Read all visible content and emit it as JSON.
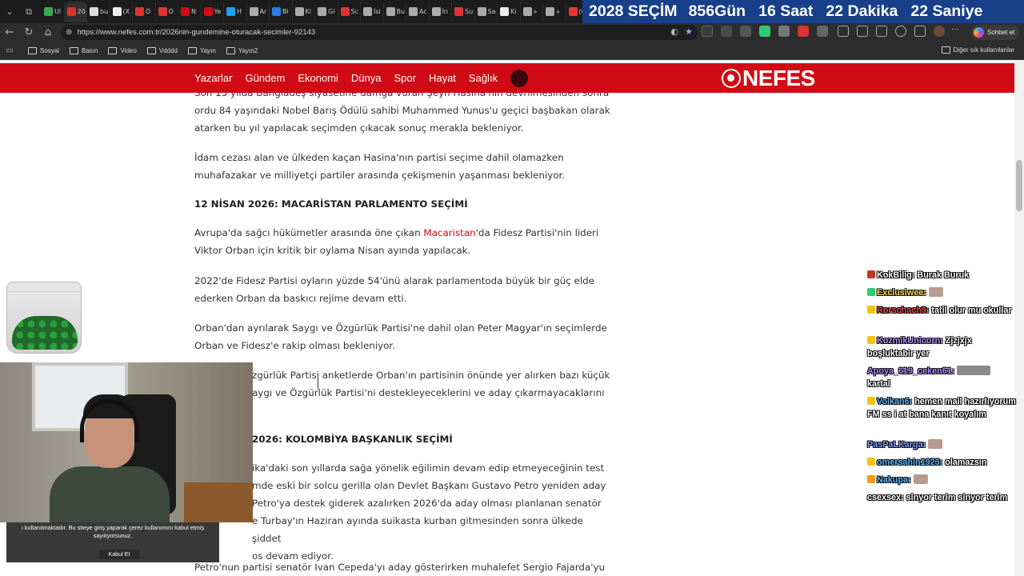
{
  "browser": {
    "tabs": [
      {
        "label": "Ul",
        "color": "#3aa757"
      },
      {
        "label": "20",
        "color": "#d33",
        "active": true
      },
      {
        "label": "bu",
        "color": "#ddd"
      },
      {
        "label": "(X",
        "color": "#eee"
      },
      {
        "label": "Ö",
        "color": "#d33"
      },
      {
        "label": "Ö",
        "color": "#d33"
      },
      {
        "label": "N",
        "color": "#d10b15"
      },
      {
        "label": "Ye",
        "color": "#d10b15"
      },
      {
        "label": "H",
        "color": "#1da1f2"
      },
      {
        "label": "Ar",
        "color": "#aaa"
      },
      {
        "label": "Bi",
        "color": "#2c7be5"
      },
      {
        "label": "Ki",
        "color": "#aaa"
      },
      {
        "label": "Gi",
        "color": "#aaa"
      },
      {
        "label": "Sc",
        "color": "#d33"
      },
      {
        "label": "İsi",
        "color": "#aaa"
      },
      {
        "label": "Bu",
        "color": "#aaa"
      },
      {
        "label": "Ac",
        "color": "#aaa"
      },
      {
        "label": "İn",
        "color": "#aaa"
      },
      {
        "label": "Su",
        "color": "#d33"
      },
      {
        "label": "Sa",
        "color": "#aaa"
      },
      {
        "label": "Ki",
        "color": "#eee"
      },
      {
        "label": "»",
        "color": "#aaa"
      },
      {
        "label": "»",
        "color": "#aaa"
      },
      {
        "label": "(6",
        "color": "#e33"
      },
      {
        "label": "(6",
        "color": "#e33"
      }
    ],
    "countdown": [
      "2028 SEÇİM",
      "856Gün",
      "16 Saat",
      "22 Dakika",
      "22 Saniye"
    ],
    "url": "https://www.nefes.com.tr/2026nin-gundemine-oturacak-secimler-92143",
    "copilot_label": "Sohbet et",
    "bookmarks": [
      "Sosyal",
      "Basın",
      "Video",
      "Vdddd",
      "Yayın",
      "Yayın2"
    ],
    "other_bookmarks": "Diğer sık kullanılanlar"
  },
  "site": {
    "nav": [
      "Yazarlar",
      "Gündem",
      "Ekonomi",
      "Dünya",
      "Spor",
      "Hayat",
      "Sağlık"
    ],
    "logo": "NEFES"
  },
  "article": {
    "p1a": "Son 15 yılda Bangladeş siyasetine damga vuran Şeyh Hasina'nın devrilmesinden sonra",
    "p1b": "ordu 84 yaşındaki Nobel Barış Ödülü sahibi Muhammed Yunus'u geçici başbakan olarak",
    "p1c": "atarken bu yıl yapılacak seçimden çıkacak sonuç merakla bekleniyor.",
    "p2a": "İdam cezası alan ve ülkeden kaçan Hasina'nın partisi seçime dahil olamazken",
    "p2b": "muhafazakar ve milliyetçi partiler arasında çekişmenin yaşanması bekleniyor.",
    "h1": "12 NİSAN 2026: MACARİSTAN PARLAMENTO SEÇİMİ",
    "p3a_pre": "Avrupa'da sağcı hükümetler arasında öne çıkan ",
    "p3a_link": "Macaristan",
    "p3a_post": "'da Fidesz Partisi'nin lideri",
    "p3b": "Viktor Orban için kritik bir oylama Nisan ayında yapılacak.",
    "p4a": "2022'de Fidesz Partisi oyların yüzde 54'ünü alarak parlamentoda büyük bir güç elde",
    "p4b": "ederken Orban da baskıcı rejime devam etti.",
    "p5a": "Orban'dan ayrılarak Saygı ve Özgürlük Partisi'ne dahil olan Peter Magyar'ın seçimlerde",
    "p5b": "Orban ve Fidesz'e rakip olması bekleniyor.",
    "p6a": "zgürlük Partisi anketlerde Orban'ın partisinin önünde yer alırken bazı küçük",
    "p6b": "aygı ve Özgürlük Partisi'ni destekleyeceklerini ve aday çıkarmayacaklarını",
    "h2": "2026: KOLOMBİYA BAŞKANLIK SEÇİMİ",
    "p7a": "ika'daki son yıllarda sağa yönelik eğilimin devam edip etmeyeceğinin test",
    "p7b": "mde eski bir solcu gerilla olan Devlet Başkanı Gustavo Petro yeniden aday",
    "p7c": "Petro'ya destek giderek azalırken 2026'da aday olması planlanan senatör",
    "p7d": "e Turbay'ın Haziran ayında suikasta kurban gitmesinden sonra ülkede şiddet",
    "p7e": "os devam ediyor.",
    "p8a": "Petro'nun partisi senatör Ivan Cepeda'yı aday gösterirken muhalefet Sergio Fajarda'yu"
  },
  "cookie": {
    "text": "ı kullanılmaktadır. Bu siteye giriş yaparak çerez kullanımını kabul etmiş sayılıyorsunuz.",
    "button": "Kabul Et"
  },
  "chat": [
    {
      "user": "KokBilig:",
      "msg": "Burak Buruk",
      "color": "#ffffff",
      "badge": "#c0392b"
    },
    {
      "user": "Exclusiwee:",
      "msg": "",
      "color": "#f5e050",
      "badge": "#2ecc71",
      "emote": true
    },
    {
      "user": "Rorschach9:",
      "msg": "tatil olur mu okullar",
      "color": "#e84a4a",
      "badge": "#f1c40f"
    },
    {
      "user": "KozmikUnicorn:",
      "msg": "Zjzjxjx boşluktabir yer",
      "color": "#b58cff",
      "badge": "#f1c40f"
    },
    {
      "user": "Apoya_619_ceken61:",
      "msg": "kartal",
      "color": "#b58cff",
      "badge": "",
      "wide_emote": true
    },
    {
      "user": "Volkan6:",
      "msg": "hemen mail hazırlıyorum FM ss i at bana kanıt koyalım",
      "color": "#5ab7ff",
      "badge": "#f1c40f"
    },
    {
      "user": "PasPaLKarga:",
      "msg": "",
      "color": "#7aa0ff",
      "badge": "",
      "emote": true
    },
    {
      "user": "omersahin1923:",
      "msg": "olamazsın",
      "color": "#5ab7ff",
      "badge": "#f1c40f"
    },
    {
      "user": "Nakupa:",
      "msg": "",
      "color": "#5ab7ff",
      "badge": "#f39c12",
      "emote": true
    },
    {
      "user": "csexsex:",
      "msg": "sinyor terim sinyor terim",
      "color": "#ffffff",
      "badge": ""
    }
  ]
}
